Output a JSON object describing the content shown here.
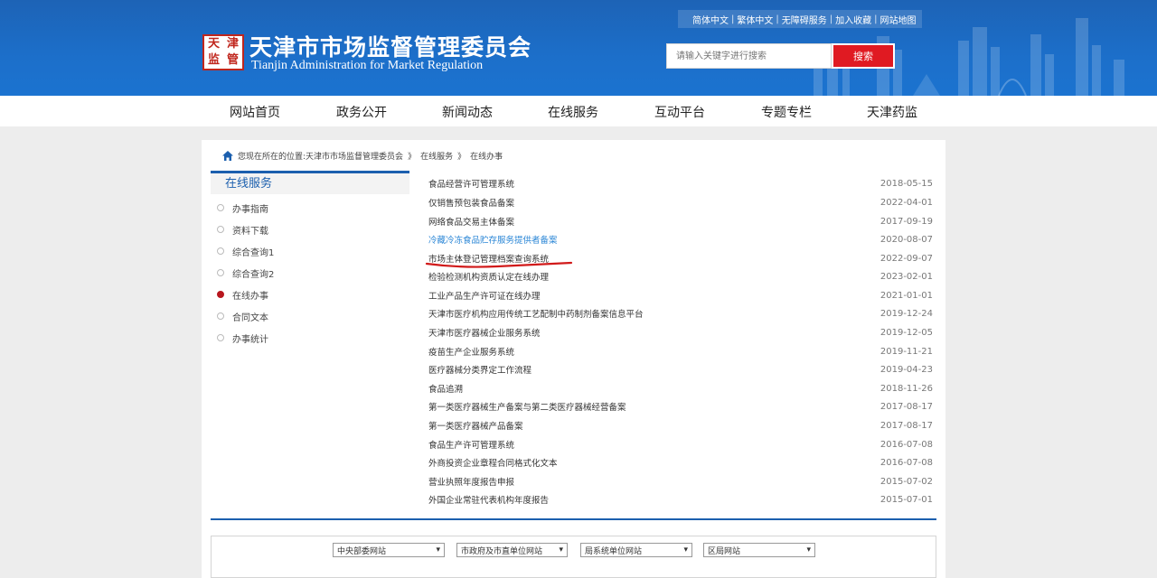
{
  "header": {
    "top_links": [
      "简体中文",
      "繁体中文",
      "无障碍服务",
      "加入收藏",
      "网站地图"
    ],
    "logo_chars": [
      "天",
      "津",
      "监",
      "管"
    ],
    "title": "天津市市场监督管理委员会",
    "subtitle": "Tianjin Administration for Market Regulation",
    "search_placeholder": "请输入关键字进行搜索",
    "search_button": "搜索"
  },
  "nav": {
    "items": [
      "网站首页",
      "政务公开",
      "新闻动态",
      "在线服务",
      "互动平台",
      "专题专栏",
      "天津药监"
    ]
  },
  "breadcrumb": {
    "prefix": "您现在所在的位置:",
    "items": [
      "天津市市场监督管理委员会",
      "在线服务",
      "在线办事"
    ],
    "separator": "》"
  },
  "sidebar": {
    "title": "在线服务",
    "items": [
      {
        "label": "办事指南",
        "active": false
      },
      {
        "label": "资料下载",
        "active": false
      },
      {
        "label": "综合查询1",
        "active": false
      },
      {
        "label": "综合查询2",
        "active": false
      },
      {
        "label": "在线办事",
        "active": true
      },
      {
        "label": "合同文本",
        "active": false
      },
      {
        "label": "办事统计",
        "active": false
      }
    ]
  },
  "list": [
    {
      "title": "食品经营许可管理系统",
      "date": "2018-05-15"
    },
    {
      "title": "仅销售预包装食品备案",
      "date": "2022-04-01"
    },
    {
      "title": "网络食品交易主体备案",
      "date": "2017-09-19"
    },
    {
      "title": "冷藏冷冻食品贮存服务提供者备案",
      "date": "2020-08-07",
      "link": true
    },
    {
      "title": "市场主体登记管理档案查询系统",
      "date": "2022-09-07"
    },
    {
      "title": "检验检测机构资质认定在线办理",
      "date": "2023-02-01"
    },
    {
      "title": "工业产品生产许可证在线办理",
      "date": "2021-01-01"
    },
    {
      "title": "天津市医疗机构应用传统工艺配制中药制剂备案信息平台",
      "date": "2019-12-24"
    },
    {
      "title": "天津市医疗器械企业服务系统",
      "date": "2019-12-05"
    },
    {
      "title": "疫苗生产企业服务系统",
      "date": "2019-11-21"
    },
    {
      "title": "医疗器械分类界定工作流程",
      "date": "2019-04-23"
    },
    {
      "title": "食品追溯",
      "date": "2018-11-26"
    },
    {
      "title": "第一类医疗器械生产备案与第二类医疗器械经营备案",
      "date": "2017-08-17"
    },
    {
      "title": "第一类医疗器械产品备案",
      "date": "2017-08-17"
    },
    {
      "title": "食品生产许可管理系统",
      "date": "2016-07-08"
    },
    {
      "title": "外商投资企业章程合同格式化文本",
      "date": "2016-07-08"
    },
    {
      "title": "营业执照年度报告申报",
      "date": "2015-07-02"
    },
    {
      "title": "外国企业常驻代表机构年度报告",
      "date": "2015-07-01"
    }
  ],
  "footer_selects": [
    "中央部委网站",
    "市政府及市直单位网站",
    "局系统单位网站",
    "区局网站"
  ],
  "colors": {
    "header_blue": "#1c6fca",
    "accent_red": "#e01a22",
    "nav_blue": "#1b5fae",
    "link_blue": "#2a86d6"
  }
}
